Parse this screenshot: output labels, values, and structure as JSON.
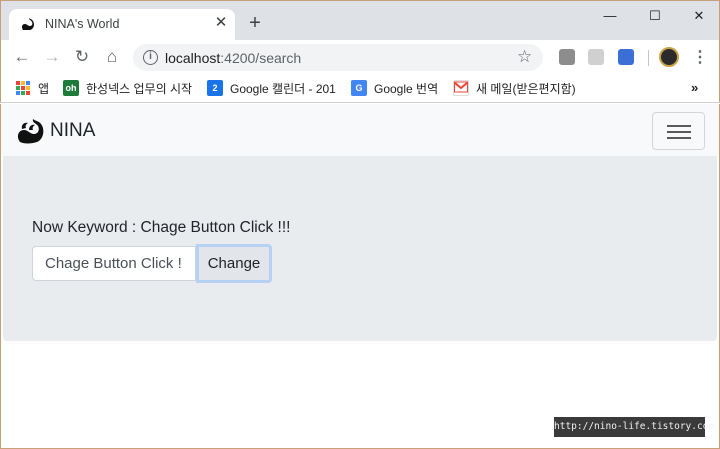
{
  "browser": {
    "tab": {
      "title": "NINA's World",
      "close_glyph": "✕"
    },
    "new_tab_glyph": "+",
    "window_controls": {
      "minimize": "—",
      "maximize": "☐",
      "close": "✕"
    },
    "nav": {
      "back": "←",
      "forward": "→",
      "reload": "↻",
      "home": "⌂"
    },
    "address": {
      "host": "localhost",
      "path": ":4200/search"
    },
    "star_glyph": "☆",
    "menu_glyph": "⋮",
    "bookmarks": [
      {
        "label": "앱",
        "icon": "apps-grid-icon",
        "color": "#e8453c"
      },
      {
        "label": "한성넥스 업무의 시작",
        "icon": "oh-logo-icon",
        "color": "#1e7a3a"
      },
      {
        "label": "Google 캘린더 - 201",
        "icon": "calendar-icon",
        "color": "#1a73e8"
      },
      {
        "label": "Google 번역",
        "icon": "translate-icon",
        "color": "#4285f4"
      },
      {
        "label": "새 메일(받은편지함)",
        "icon": "gmail-icon",
        "color": "#ea4335"
      }
    ],
    "bookmarks_overflow": "»"
  },
  "navbar": {
    "brand": "NINA"
  },
  "search": {
    "keyword_text": "Now Keyword : Chage Button Click !!!",
    "input_value": "Chage Button Click !!!",
    "button_label": "Change"
  },
  "watermark": "http://nino-life.tistory.com",
  "colors": {
    "chrome_bg": "#dee1e6",
    "navbar_bg": "#f8f9fa",
    "jumbotron_bg": "#e9ecef",
    "button_focus": "#b6d1f3"
  }
}
